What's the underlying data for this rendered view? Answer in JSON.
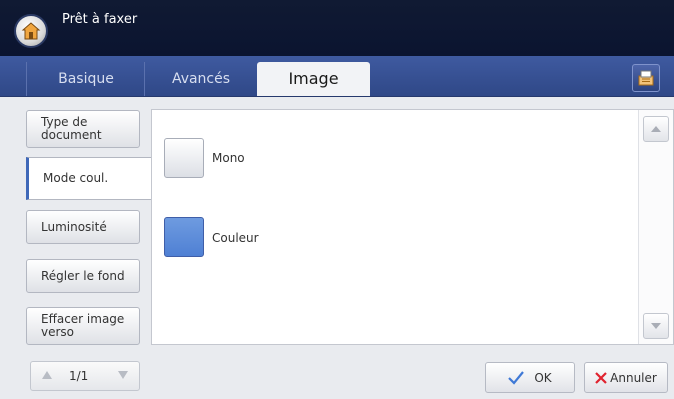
{
  "header": {
    "title": "Prêt à faxer",
    "home_icon": "home-icon"
  },
  "tabs": [
    {
      "label": "Basique",
      "active": false
    },
    {
      "label": "Avancés",
      "active": false
    },
    {
      "label": "Image",
      "active": true
    }
  ],
  "side_menu": [
    {
      "label": "Type de document",
      "active": false
    },
    {
      "label": "Mode coul.",
      "active": true
    },
    {
      "label": "Luminosité",
      "active": false
    },
    {
      "label": "Régler le fond",
      "active": false
    },
    {
      "label": "Effacer image verso",
      "active": false
    }
  ],
  "color_options": [
    {
      "label": "Mono",
      "selected": false
    },
    {
      "label": "Couleur",
      "selected": true
    }
  ],
  "pager": {
    "text": "1/1"
  },
  "footer": {
    "ok_label": "OK",
    "cancel_label": "Annuler"
  },
  "colors": {
    "accent": "#4f80d4",
    "topbar": "#0b1430",
    "tabbar": "#2f4887"
  }
}
